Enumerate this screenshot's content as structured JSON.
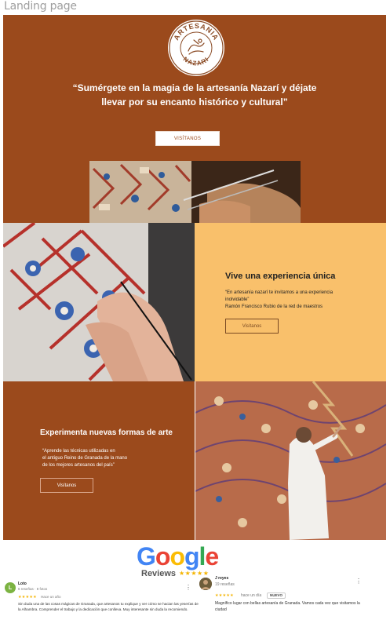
{
  "page": {
    "title": "Landing page"
  },
  "hero": {
    "logo_top_text": "ARTESANIA",
    "logo_bottom_text": "NAZARI",
    "tagline_line1": "“Sumérgete en la magia de la artesanía Nazarí y déjate",
    "tagline_line2": "llevar por su encanto histórico y cultural”",
    "button_label": "VISÍTANOS"
  },
  "section_experience": {
    "title": "Vive una experiencia única",
    "quote": "“En artesanía nazarí te invitamos a una experiencia inolvidable”",
    "author": "Ramón Francisco Rubio de la red de maestros",
    "button_label": "Visítanos"
  },
  "section_art": {
    "title": "Experimenta nuevas formas de arte",
    "quote_line1": "“Aprende las técnicas utilizadas en",
    "quote_line2": "el antiguo Reino de Granada de la mano",
    "quote_line3": "de los mejores artesanos del país”",
    "button_label": "Visítanos"
  },
  "reviews": {
    "brand_letters": [
      "G",
      "o",
      "o",
      "g",
      "l",
      "e"
    ],
    "brand_colors": [
      "#4285F4",
      "#EA4335",
      "#FBBC05",
      "#4285F4",
      "#34A853",
      "#EA4335"
    ],
    "label": "Reviews",
    "stars": "★★★★★",
    "items": [
      {
        "avatar_letter": "L",
        "name": "Loto",
        "meta": "6 reseñas · 8 fotos",
        "stars": "★★★★★",
        "time": "Hace un año",
        "badge": "",
        "text": "Sin duda una de las cosas mágicas de Granada, que artesanos tu explique y ver cómo se hacian las yeserías de la Alhambra. Comprender el trabajo y la dedicación que conlleva. Muy interesante sin duda la recomiendo."
      },
      {
        "avatar_letter": "",
        "name": "J reyes",
        "meta": "19 reseñas",
        "stars": "★★★★★",
        "time": "hace un día",
        "badge": "NUEVO",
        "text": "Magnífico lugar con bellas artesanía de Granada. Vamos cada vez que visitamos la ciudad"
      }
    ]
  },
  "colors": {
    "brown": "#9b4a1c",
    "peach": "#f9c06b",
    "star": "#f4b400"
  }
}
